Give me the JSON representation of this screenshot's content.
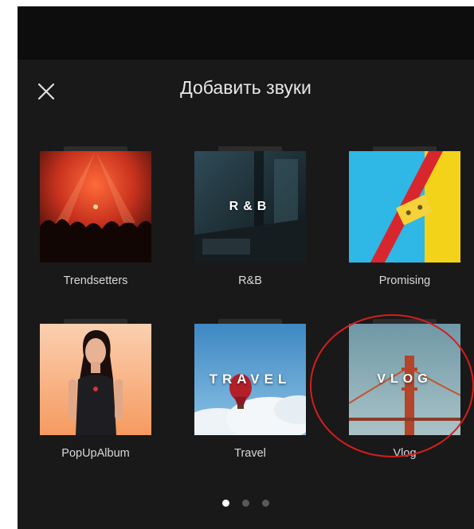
{
  "header": {
    "title": "Добавить звуки",
    "close_icon": "close-icon"
  },
  "albums": [
    {
      "name": "Trendsetters",
      "cover_text": ""
    },
    {
      "name": "R&B",
      "cover_text": "R&B"
    },
    {
      "name": "Promising",
      "cover_text": ""
    },
    {
      "name": "PopUpAlbum",
      "cover_text": ""
    },
    {
      "name": "Travel",
      "cover_text": "TRAVEL"
    },
    {
      "name": "Vlog",
      "cover_text": "VLOG"
    }
  ],
  "pagination": {
    "current_page": 1,
    "page_count": 3
  },
  "colors": {
    "background": "#191919",
    "top_bar": "#0d0d0d",
    "text": "#d9d9d9",
    "highlight_circle": "#d41e1e",
    "dot_active": "#ffffff",
    "dot_inactive": "#5a5a5a"
  }
}
